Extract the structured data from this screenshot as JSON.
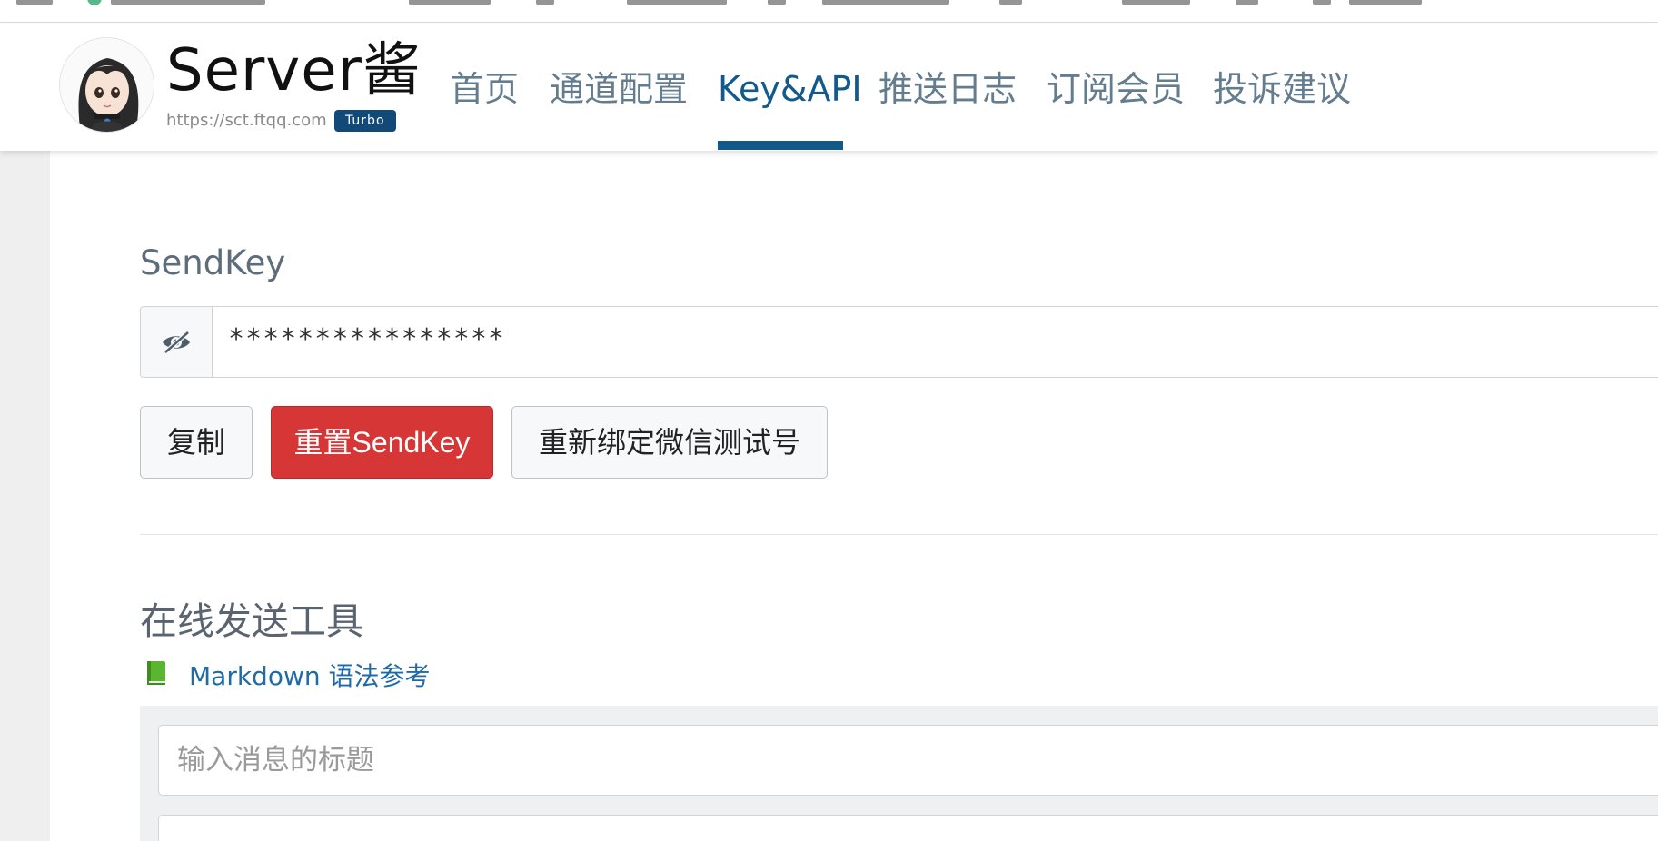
{
  "brand": {
    "title": "Server酱",
    "url": "https://sct.ftqq.com",
    "badge": "Turbo"
  },
  "nav": {
    "items": [
      {
        "label": "首页",
        "active": false
      },
      {
        "label": "通道配置",
        "active": false
      },
      {
        "label": "Key&API",
        "active": true
      },
      {
        "label": "推送日志",
        "active": false
      },
      {
        "label": "订阅会员",
        "active": false
      },
      {
        "label": "投诉建议",
        "active": false
      }
    ]
  },
  "sendkey": {
    "label": "SendKey",
    "masked_value": "****************",
    "toggle_icon": "eye-slash-icon"
  },
  "actions": {
    "copy": "复制",
    "reset": "重置SendKey",
    "rebind": "重新绑定微信测试号"
  },
  "tool": {
    "title": "在线发送工具",
    "markdown_link": "Markdown 语法参考",
    "title_placeholder": "输入消息的标题"
  },
  "colors": {
    "accent": "#135a8c",
    "danger": "#d73637",
    "badge": "#114a78"
  }
}
